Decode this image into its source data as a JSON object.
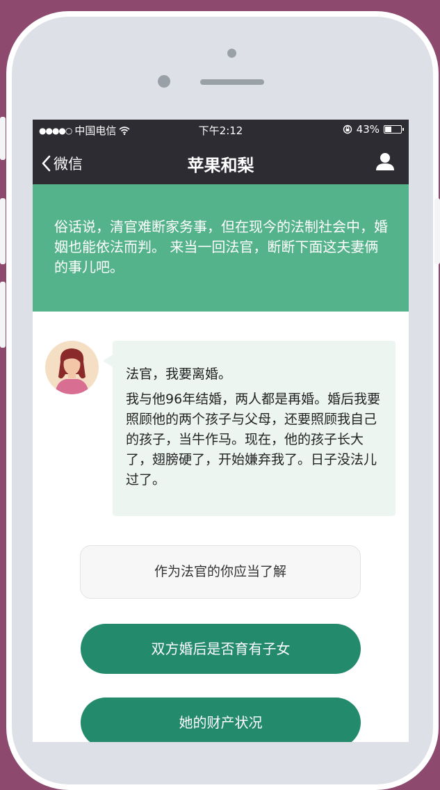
{
  "statusbar": {
    "carrier": "中国电信",
    "time": "下午2:12",
    "battery": "43%",
    "battery_level": 0.43
  },
  "navbar": {
    "back_label": "微信",
    "title": "苹果和梨"
  },
  "banner": {
    "text": "俗话说，清官难断家务事，但在现今的法制社会中，婚姻也能依法而判。 来当一回法官，断断下面这夫妻俩的事儿吧。"
  },
  "message": {
    "greeting": "法官，我要离婚。",
    "body": "我与他96年结婚，两人都是再婚。婚后我要照顾他的两个孩子与父母，还要照顾我自己的孩子，当牛作马。现在，他的孩子长大了，翅膀硬了，开始嫌弃我了。日子没法儿过了。"
  },
  "question": {
    "label": "作为法官的你应当了解"
  },
  "answers": [
    {
      "label": "双方婚后是否育有子女"
    },
    {
      "label": "她的财产状况"
    }
  ],
  "colors": {
    "background": "#8e4a6e",
    "bar": "#2d2c33",
    "banner": "#55b38c",
    "button": "#238a6c",
    "bubble": "#edf5f1"
  }
}
